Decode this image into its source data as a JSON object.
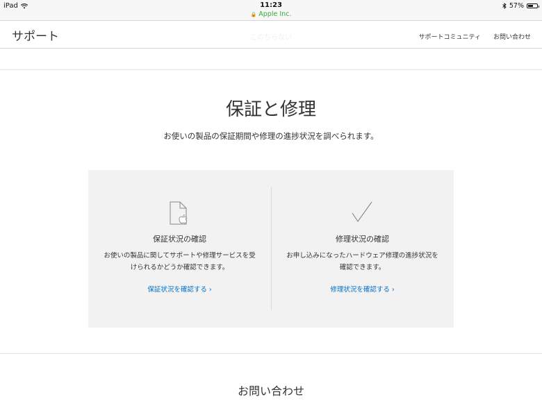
{
  "status_bar": {
    "device": "iPad",
    "time": "11:23",
    "battery": "57%",
    "battery_level": 0.57
  },
  "browser": {
    "url_text": "Apple Inc."
  },
  "nav": {
    "title": "サポート",
    "faded_text": "このちらない",
    "links": [
      "サポートコミュニティ",
      "お問い合わせ"
    ]
  },
  "hero": {
    "title": "保証と修理",
    "subtitle": "お使いの製品の保証期間や修理の進捗状況を調べられます。"
  },
  "cards": [
    {
      "icon": "document-apple-icon",
      "title": "保証状況の確認",
      "description_lines": [
        "お使いの製品に関してサポートや修理サービスを受",
        "けられるかどうか確認できます。"
      ],
      "link": "保証状況を確認する ›"
    },
    {
      "icon": "checkmark-icon",
      "title": "修理状況の確認",
      "description_lines": [
        "お申し込みになったハードウェア修理の進捗状況を",
        "確認できます。"
      ],
      "link": "修理状況を確認する ›"
    }
  ],
  "footer": {
    "contact_title": "お問い合わせ"
  },
  "colors": {
    "link": "#0070c9",
    "secure_url": "#3aa83a",
    "panel_bg": "#f2f2f2"
  }
}
